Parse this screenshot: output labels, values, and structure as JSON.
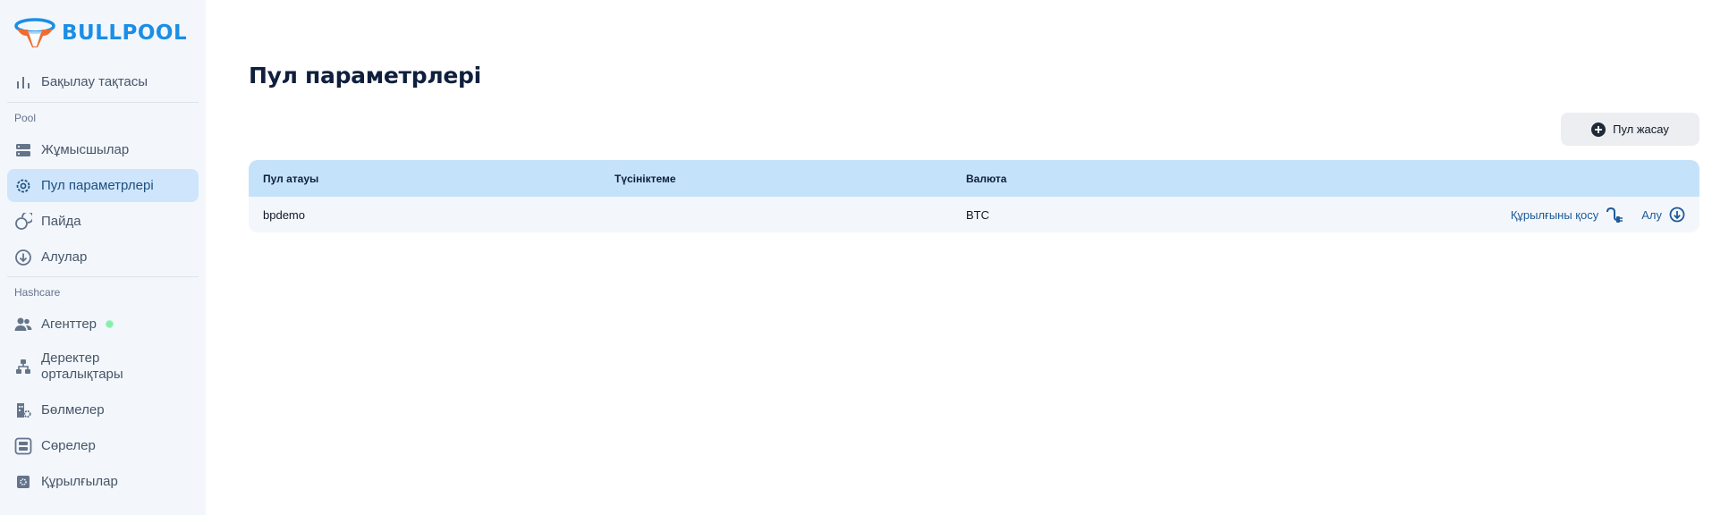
{
  "app": {
    "brand": "BULLPOOL"
  },
  "sidebar": {
    "items": [
      {
        "label": "Бақылау тақтасы",
        "icon": "bar-chart-icon"
      },
      {
        "label": "Жұмысшылар",
        "icon": "server-stack-icon"
      },
      {
        "label": "Пул параметрлері",
        "icon": "gear-icon",
        "active": true
      },
      {
        "label": "Пайда",
        "icon": "coins-icon"
      },
      {
        "label": "Алулар",
        "icon": "arrow-down-circle-icon"
      },
      {
        "label": "Агенттер",
        "icon": "users-icon",
        "status": "online"
      },
      {
        "label": "Деректер орталықтары",
        "icon": "network-icon"
      },
      {
        "label": "Бөлмелер",
        "icon": "building-gear-icon"
      },
      {
        "label": "Сөрелер",
        "icon": "rack-icon"
      },
      {
        "label": "Құрылғылар",
        "icon": "chip-icon"
      }
    ],
    "sections": {
      "pool": "Pool",
      "hashcare": "Hashcare"
    }
  },
  "main": {
    "title": "Пул параметрлері",
    "create_button": "Пул жасау",
    "table": {
      "headers": [
        "Пул атауы",
        "Түсініктеме",
        "Валюта"
      ],
      "rows": [
        {
          "name": "bpdemo",
          "description": "",
          "currency": "BTC",
          "connect_label": "Құрылғыны қосу",
          "withdraw_label": "Алу"
        }
      ]
    }
  },
  "colors": {
    "accent": "#1b8ee6",
    "active_bg": "#cfe5fb",
    "table_header": "#c5e2fb",
    "link": "#1e5a98",
    "logo_orange": "#f26b2a"
  }
}
